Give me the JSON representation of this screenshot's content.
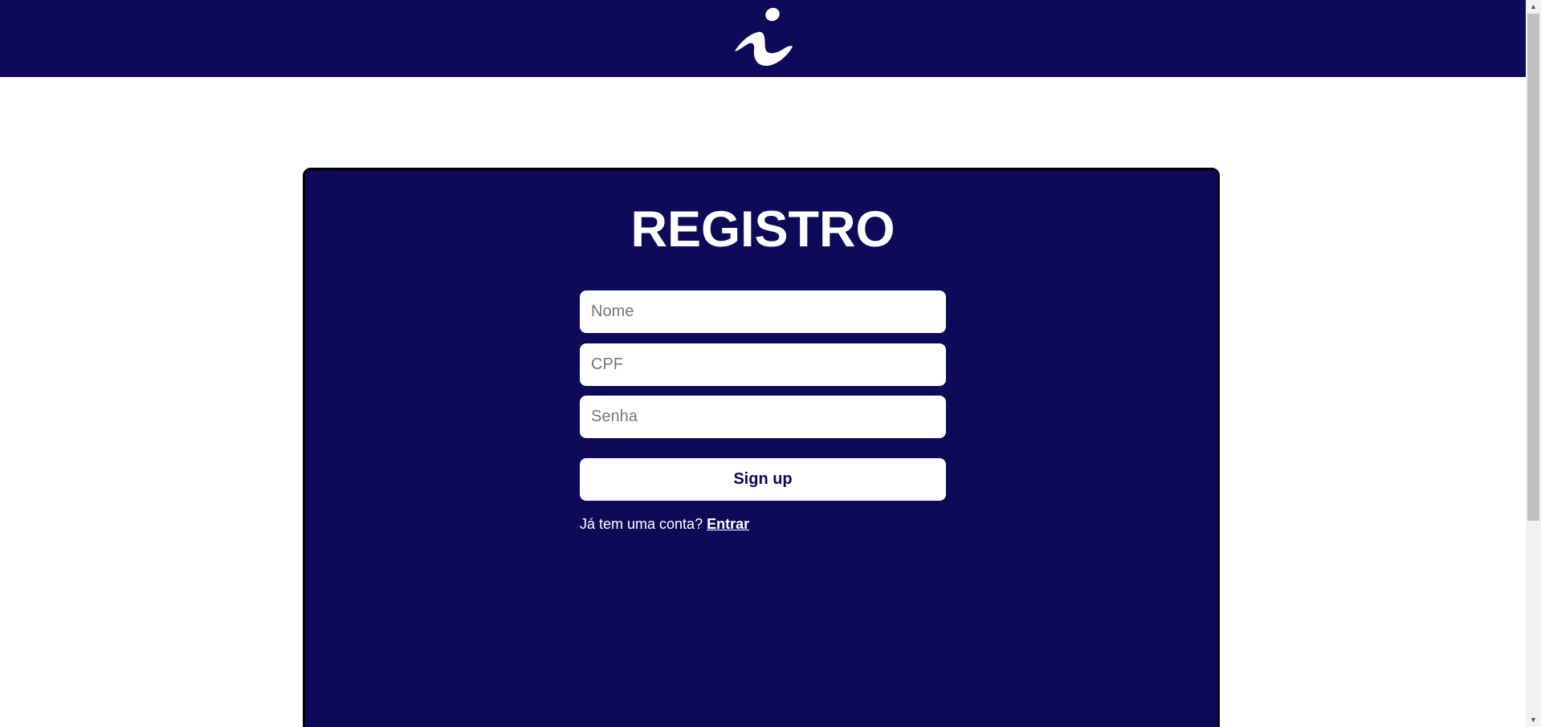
{
  "header": {
    "logo_icon": "stylized-i-logo-icon"
  },
  "form": {
    "title": "REGISTRO",
    "name_placeholder": "Nome",
    "cpf_placeholder": "CPF",
    "password_placeholder": "Senha",
    "signup_label": "Sign up",
    "login_prompt": "Já tem uma conta?",
    "login_link": "Entrar"
  },
  "colors": {
    "primary": "#0e0a5a",
    "background": "#ffffff",
    "text_on_primary": "#ffffff"
  }
}
